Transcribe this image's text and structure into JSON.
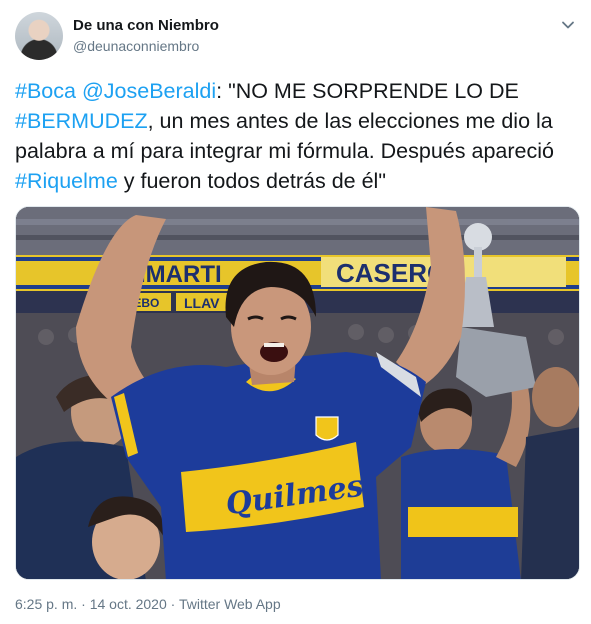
{
  "author": {
    "name": "De una con Niembro",
    "handle": "@deunaconniembro"
  },
  "tweet": {
    "parts": [
      {
        "text": "#Boca",
        "link": true
      },
      {
        "text": " ",
        "link": false
      },
      {
        "text": "@JoseBeraldi",
        "link": true
      },
      {
        "text": ": \"NO ME SORPRENDE LO DE ",
        "link": false
      },
      {
        "text": "#BERMUDEZ",
        "link": true
      },
      {
        "text": ", un mes antes de las elecciones me dio la palabra a mí para integrar mi fórmula. Después apareció ",
        "link": false
      },
      {
        "text": "#Riquelme",
        "link": true
      },
      {
        "text": " y fueron todos detrás de él\"",
        "link": false
      }
    ]
  },
  "media": {
    "banner_left": "ANMARTI",
    "banner_right": "CASEROS",
    "banner_lower": "LLAV",
    "banner_lower_left": "ACEBO",
    "jersey_sponsor": "Quilmes"
  },
  "meta": {
    "timestamp": "6:25 p. m. · 14 oct. 2020 · Twitter Web App"
  },
  "colors": {
    "link": "#1da1f2",
    "secondary": "#657786",
    "boca_blue": "#1b3a8f",
    "boca_yellow": "#f2c81b"
  },
  "icons": {
    "more": "chevron-down-icon"
  }
}
